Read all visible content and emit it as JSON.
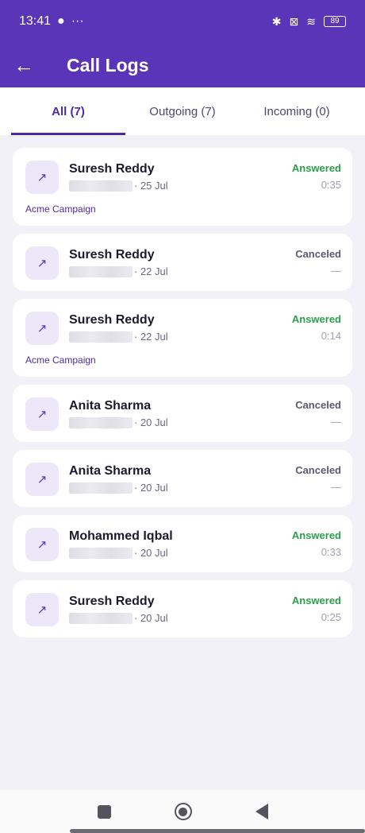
{
  "status_bar": {
    "time": "13:41",
    "notif_glyph": "●",
    "dots": "···",
    "bluetooth": "✱",
    "sim": "⊠",
    "wifi": "≋",
    "battery": "89"
  },
  "app_bar": {
    "back_icon": "←",
    "title": "Call Logs"
  },
  "tabs": [
    {
      "label": "All (7)"
    },
    {
      "label": "Outgoing (7)"
    },
    {
      "label": "Incoming (0)"
    }
  ],
  "calls": [
    {
      "icon": "↗",
      "name": "Suresh Reddy",
      "date": "· 25 Jul",
      "status": "Answered",
      "duration": "0:35",
      "campaign": "Acme Campaign"
    },
    {
      "icon": "↗",
      "name": "Suresh Reddy",
      "date": "· 22 Jul",
      "status": "Canceled",
      "duration": "—"
    },
    {
      "icon": "↗",
      "name": "Suresh Reddy",
      "date": "· 22 Jul",
      "status": "Answered",
      "duration": "0:14",
      "campaign": "Acme Campaign"
    },
    {
      "icon": "↗",
      "name": "Anita Sharma",
      "date": "· 20 Jul",
      "status": "Canceled",
      "duration": "—"
    },
    {
      "icon": "↗",
      "name": "Anita Sharma",
      "date": "· 20 Jul",
      "status": "Canceled",
      "duration": "—"
    },
    {
      "icon": "↗",
      "name": "Mohammed Iqbal",
      "date": "· 20 Jul",
      "status": "Answered",
      "duration": "0:33"
    },
    {
      "icon": "↗",
      "name": "Suresh Reddy",
      "date": "· 20 Jul",
      "status": "Answered",
      "duration": "0:25"
    }
  ],
  "colors": {
    "primary": "#5a35b8",
    "answered": "#2d9d4a",
    "canceled": "#5b5870"
  }
}
